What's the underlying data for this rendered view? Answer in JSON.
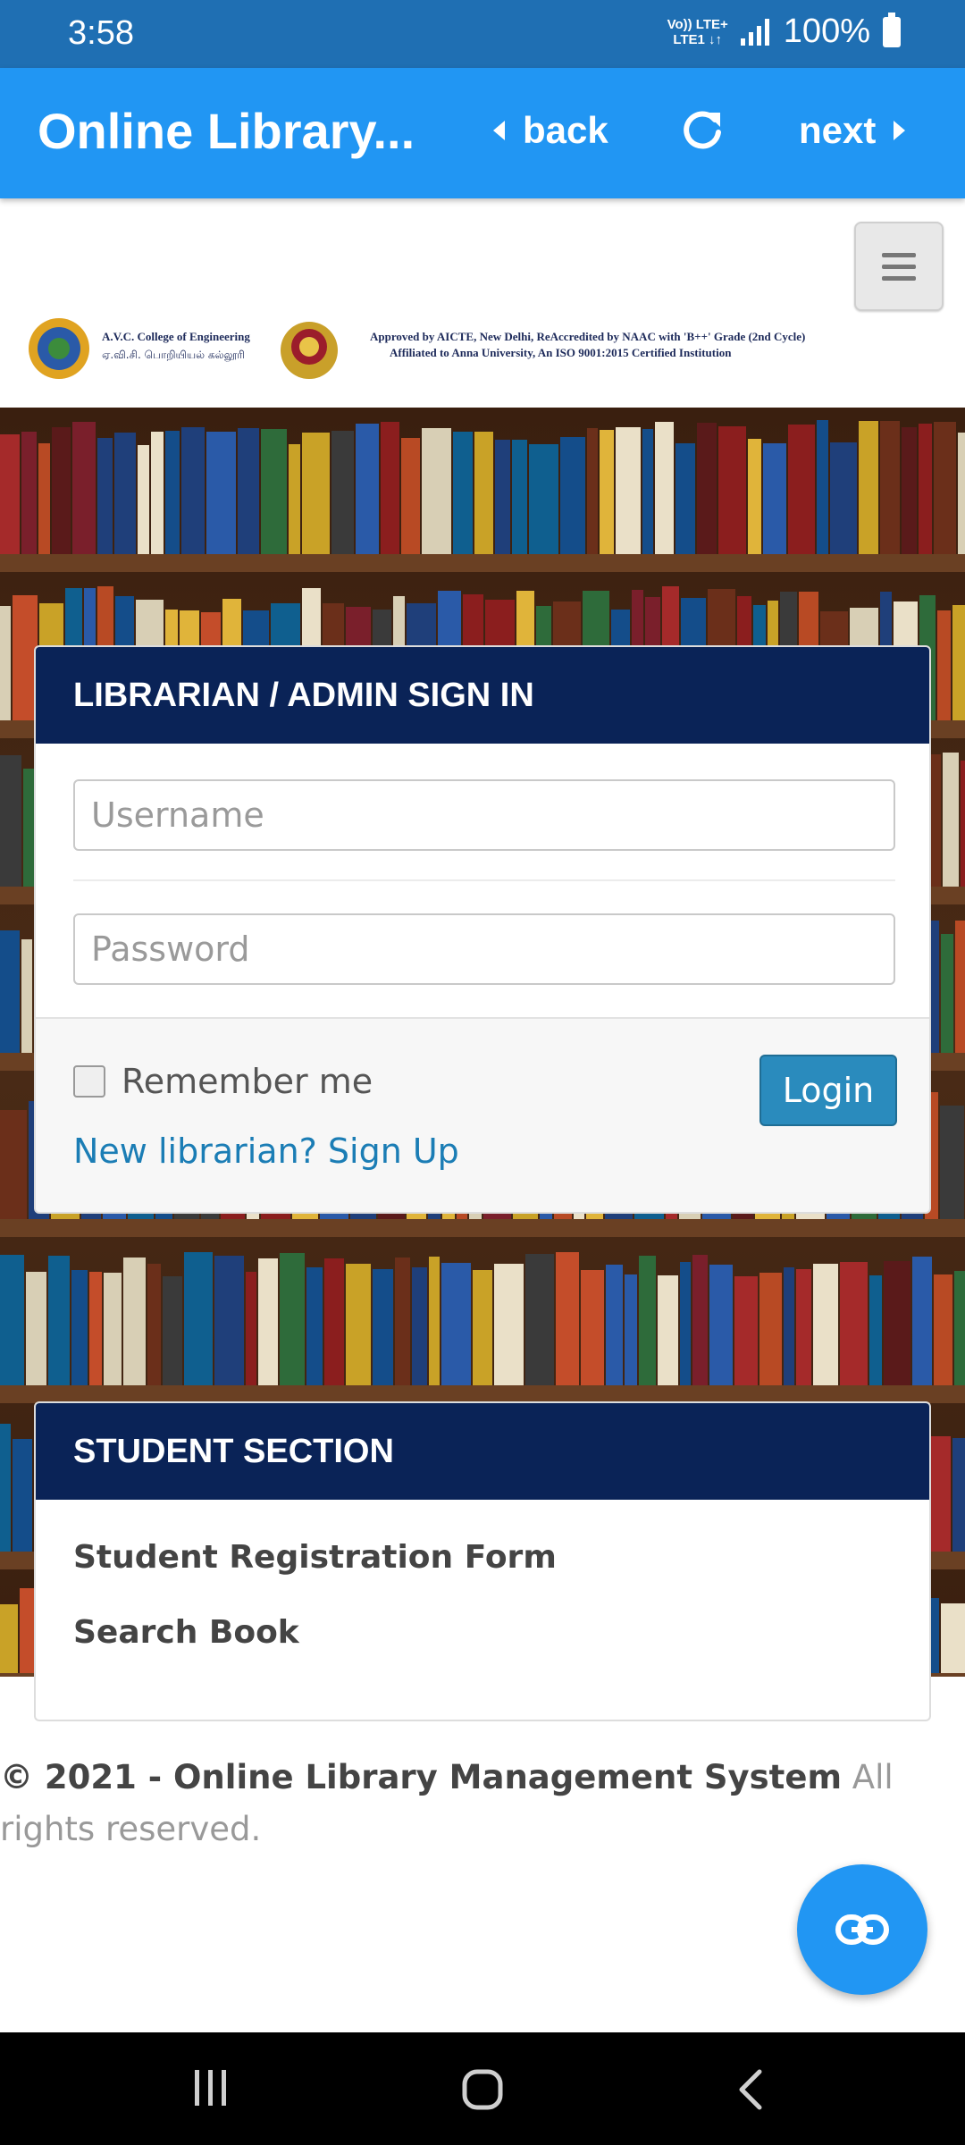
{
  "status_bar": {
    "time": "3:58",
    "network_line1": "Vo)) LTE+",
    "network_line2": "LTE1 ↓↑",
    "battery": "100%"
  },
  "app_bar": {
    "title": "Online Library...",
    "back_label": "back",
    "next_label": "next"
  },
  "header": {
    "college_name_en": "A.V.C. College of Engineering",
    "college_name_ta": "ஏ.வி.சி. பொறியியல் கல்லூரி",
    "accreditation_line1": "Approved by AICTE, New Delhi, ReAccredited by NAAC with 'B++' Grade (2nd Cycle)",
    "accreditation_line2": "Affiliated to Anna University, An ISO 9001:2015 Certified Institution"
  },
  "signin": {
    "heading": "LIBRARIAN / ADMIN SIGN IN",
    "username_placeholder": "Username",
    "password_placeholder": "Password",
    "remember_label": "Remember me",
    "login_label": "Login",
    "signup_link": "New librarian? Sign Up"
  },
  "student": {
    "heading": "STUDENT SECTION",
    "registration_link": "Student Registration Form",
    "search_link": "Search Book"
  },
  "footer": {
    "copyright": "© 2021 - Online Library Management System",
    "rights": "All rights reserved."
  },
  "colors": {
    "status_bar": "#1f6fb3",
    "app_bar": "#2196f3",
    "card_header": "#0a2357",
    "login_button": "#2a8bbd",
    "link": "#1b7db5"
  }
}
